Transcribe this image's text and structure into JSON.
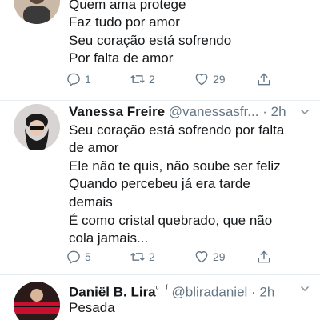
{
  "tweets": [
    {
      "name": "",
      "handle": "",
      "time": "",
      "lines": [
        "Quem ama protege",
        "Faz tudo por amor",
        "Seu coração está sofrendo",
        "Por falta de amor"
      ],
      "actions": {
        "reply": "1",
        "retweet": "2",
        "like": "29"
      }
    },
    {
      "name": "Vanessa Freire",
      "handle": "@vanessasfr...",
      "dot": "·",
      "time": "2h",
      "lines": [
        "Seu coração está sofrendo por falta",
        "de amor",
        "Ele não te quis, não soube ser feliz",
        "Quando percebeu já era tarde",
        "demais",
        "É como cristal quebrado, que não",
        "cola jamais..."
      ],
      "actions": {
        "reply": "5",
        "retweet": "2",
        "like": "29"
      }
    },
    {
      "name": "Daniël B. Lira",
      "name_badge": "ᶜ ʳ ᶠ",
      "handle": "@bliradaniel",
      "dot": "·",
      "time": "2h",
      "lines": [
        "Pesada"
      ]
    }
  ],
  "icons": {
    "reply": "reply-icon",
    "retweet": "retweet-icon",
    "like": "heart-icon",
    "share": "share-icon",
    "more": "chevron-down-icon"
  },
  "colors": {
    "text": "#14171a",
    "muted": "#657786",
    "divider": "#e6ecf0"
  }
}
